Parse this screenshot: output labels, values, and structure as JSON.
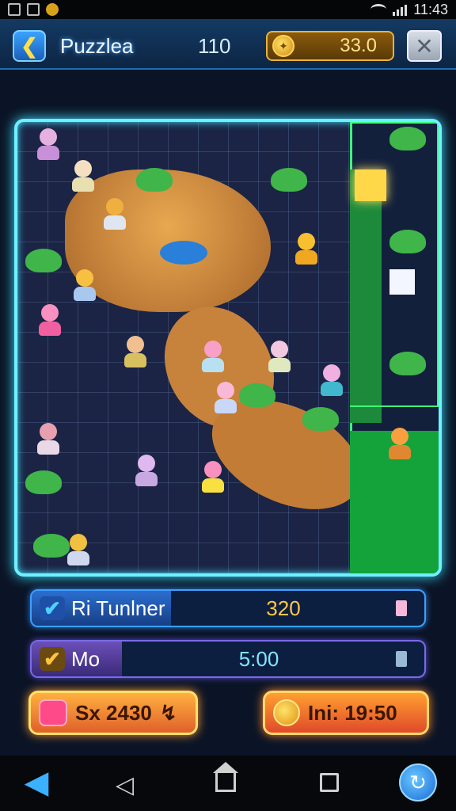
{
  "status_bar": {
    "time": "11:43",
    "icons": [
      "image-icon",
      "gallery-icon",
      "coin-notification-icon",
      "wifi-icon",
      "cellular-signal-icon"
    ]
  },
  "header": {
    "back_icon": "arrow-left-icon",
    "title": "Puzzlea",
    "score": "110",
    "coin_icon": "gold-coin-icon",
    "coins": "33.0",
    "close_icon": "close-icon"
  },
  "board": {
    "accent": "#6ff0ff",
    "side_accent": "#40ff7a"
  },
  "info_bars": [
    {
      "icon": "checkmark-icon",
      "label": "Ri Tunlner",
      "value": "320",
      "end_icon": "battery-icon"
    },
    {
      "icon": "checkmark-icon",
      "label": "Mo",
      "value": "5:00",
      "end_icon": "battery-icon"
    }
  ],
  "buttons": {
    "left_label": "Sx 2430",
    "left_suffix": "↯",
    "right_label": "Ini: 19:50"
  },
  "nav_bar": {
    "left_icon": "rewind-icon",
    "back_icon": "nav-back-icon",
    "home_icon": "home-icon",
    "recent_icon": "recent-apps-icon",
    "right_icon": "refresh-icon"
  }
}
